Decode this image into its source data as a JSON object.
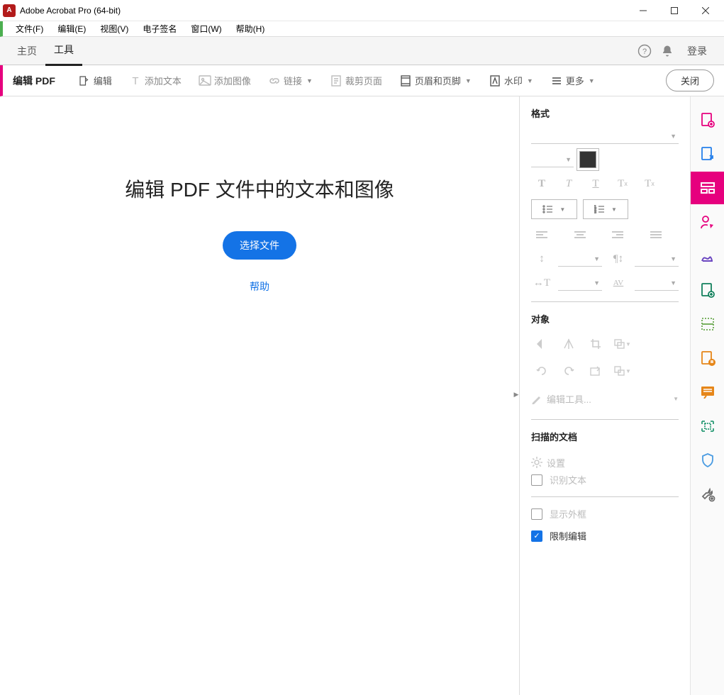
{
  "titlebar": {
    "title": "Adobe Acrobat Pro (64-bit)"
  },
  "menubar": {
    "items": [
      "文件(F)",
      "编辑(E)",
      "视图(V)",
      "电子签名",
      "窗口(W)",
      "帮助(H)"
    ]
  },
  "toptabs": {
    "home": "主页",
    "tools": "工具",
    "login": "登录"
  },
  "toolbar": {
    "title": "编辑 PDF",
    "edit": "编辑",
    "add_text": "添加文本",
    "add_image": "添加图像",
    "link": "链接",
    "crop": "裁剪页面",
    "header_footer": "页眉和页脚",
    "watermark": "水印",
    "more": "更多",
    "close": "关闭"
  },
  "main": {
    "welcome": "编辑 PDF 文件中的文本和图像",
    "select_file": "选择文件",
    "help": "帮助"
  },
  "rpanel": {
    "format_title": "格式",
    "object_title": "对象",
    "edit_tools": "编辑工具...",
    "scanned_title": "扫描的文档",
    "settings": "设置",
    "recognize_text": "识别文本",
    "show_outline": "显示外框",
    "restrict_edit": "限制编辑"
  }
}
